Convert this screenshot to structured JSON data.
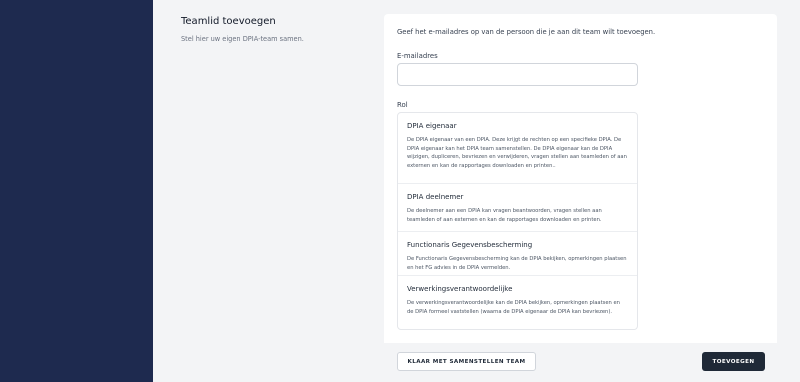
{
  "intro": {
    "title": "Teamlid toevoegen",
    "subtitle": "Stel hier uw eigen DPIA-team samen."
  },
  "form": {
    "description": "Geef het e-mailadres op van de persoon die je aan dit team wilt toevoegen.",
    "email_label": "E-mailadres",
    "email_value": "",
    "email_placeholder": "",
    "role_label": "Rol",
    "roles": [
      {
        "title": "DPIA eigenaar",
        "description": "De DPIA eigenaar van een DPIA. Deze krijgt de rechten op een specifieke DPIA. De DPIA eigenaar kan het DPIA team samenstellen. De DPIA eigenaar kan de DPIA wijzigen, dupliceren, bevriezen en verwijderen, vragen stellen aan teamleden of aan externen en kan de rapportages downloaden en printen.."
      },
      {
        "title": "DPIA deelnemer",
        "description": "De deelnemer aan een DPIA kan vragen beantwoorden, vragen stellen aan teamleden of aan externen en kan de rapportages downloaden en printen."
      },
      {
        "title": "Functionaris Gegevensbescherming",
        "description": "De Functionaris Gegevensbescherming kan de DPIA bekijken, opmerkingen plaatsen en het FG advies in de DPIA vermelden."
      },
      {
        "title": "Verwerkingsverantwoordelijke",
        "description": "De verwerkingsverantwoordelijke kan de DPIA bekijken, opmerkingen plaatsen en de DPIA formeel vaststellen (waarna de DPIA eigenaar de DPIA kan bevriezen)."
      }
    ]
  },
  "footer": {
    "secondary_label": "KLAAR MET SAMENSTELLEN TEAM",
    "primary_label": "TOEVOEGEN"
  },
  "colors": {
    "sidebar": "#1e2a4f",
    "primary_button": "#1f2937"
  }
}
